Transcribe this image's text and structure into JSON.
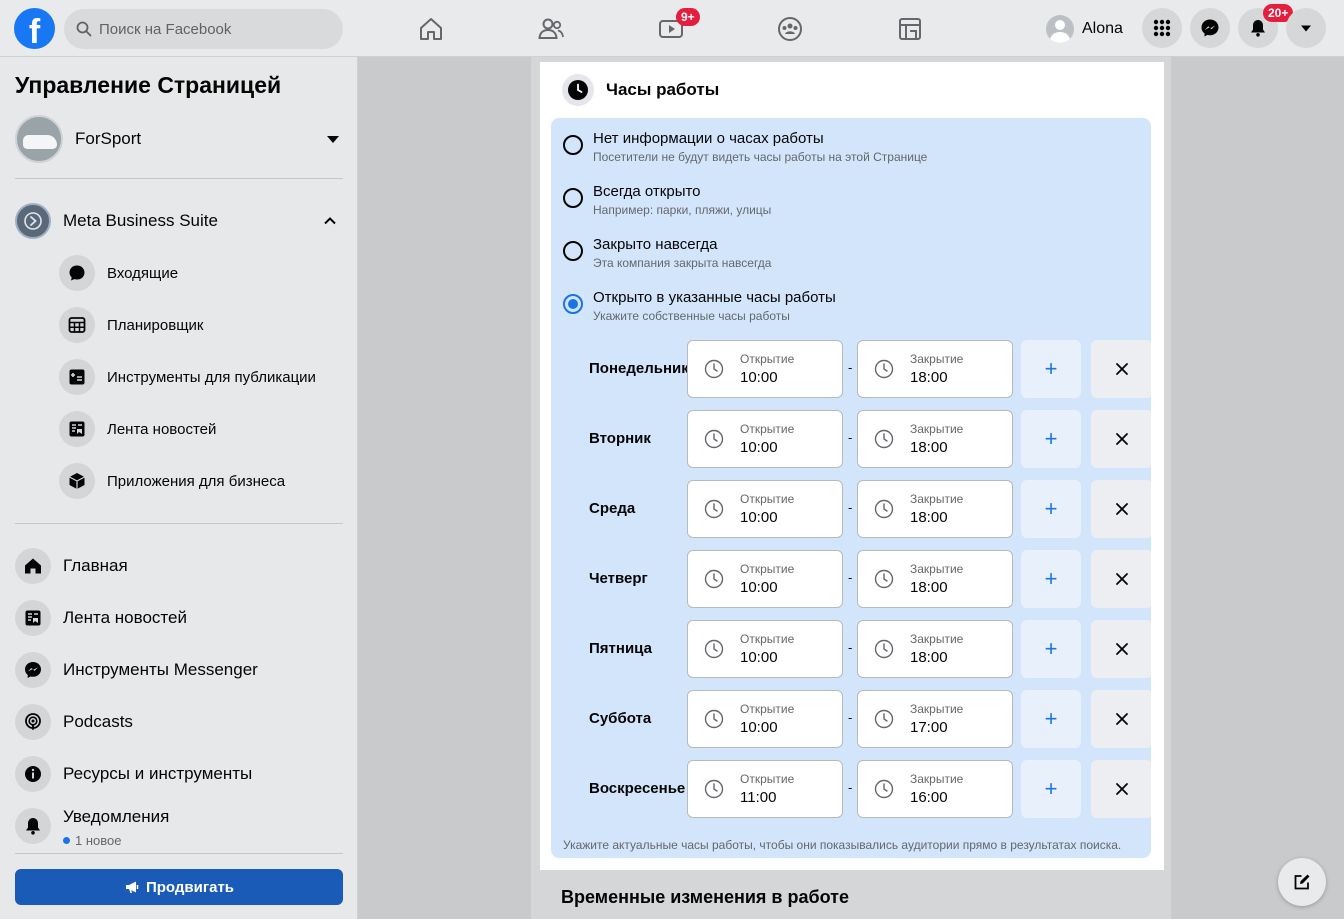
{
  "topbar": {
    "logo_letter": "f",
    "search_placeholder": "Поиск на Facebook",
    "watch_badge": "9+",
    "profile_name": "Alona",
    "notif_badge": "20+"
  },
  "sidebar": {
    "title": "Управление Страницей",
    "page_name": "ForSport",
    "suite_label": "Meta Business Suite",
    "suite_items": [
      {
        "label": "Входящие",
        "icon": "chat-icon"
      },
      {
        "label": "Планировщик",
        "icon": "calendar-icon"
      },
      {
        "label": "Инструменты для публикации",
        "icon": "publishing-tools-icon"
      },
      {
        "label": "Лента новостей",
        "icon": "news-feed-icon"
      },
      {
        "label": "Приложения для бизнеса",
        "icon": "cube-icon"
      }
    ],
    "main_items": [
      {
        "label": "Главная",
        "icon": "home-icon"
      },
      {
        "label": "Лента новостей",
        "icon": "news-feed-icon"
      },
      {
        "label": "Инструменты Messenger",
        "icon": "messenger-icon"
      },
      {
        "label": "Podcasts",
        "icon": "podcast-icon"
      },
      {
        "label": "Ресурсы и инструменты",
        "icon": "info-icon"
      },
      {
        "label": "Уведомления",
        "icon": "bell-icon"
      }
    ],
    "notif_sub": "1 новое",
    "promote_label": "Продвигать"
  },
  "hours": {
    "title": "Часы работы",
    "options": [
      {
        "label": "Нет информации о часах работы",
        "desc": "Посетители не будут видеть часы работы на этой Странице",
        "selected": false
      },
      {
        "label": "Всегда открыто",
        "desc": "Например: парки, пляжи, улицы",
        "selected": false
      },
      {
        "label": "Закрыто навсегда",
        "desc": "Эта компания закрыта навсегда",
        "selected": false
      },
      {
        "label": "Открыто в указанные часы работы",
        "desc": "Укажите собственные часы работы",
        "selected": true
      }
    ],
    "open_caption": "Открытие",
    "close_caption": "Закрытие",
    "dash": "-",
    "plus": "+",
    "days": [
      {
        "name": "Понедельник",
        "open": "10:00",
        "close": "18:00"
      },
      {
        "name": "Вторник",
        "open": "10:00",
        "close": "18:00"
      },
      {
        "name": "Среда",
        "open": "10:00",
        "close": "18:00"
      },
      {
        "name": "Четверг",
        "open": "10:00",
        "close": "18:00"
      },
      {
        "name": "Пятница",
        "open": "10:00",
        "close": "18:00"
      },
      {
        "name": "Суббота",
        "open": "10:00",
        "close": "17:00"
      },
      {
        "name": "Воскресенье",
        "open": "11:00",
        "close": "16:00"
      }
    ],
    "hint": "Укажите актуальные часы работы, чтобы они показывались аудитории прямо в результатах поиска."
  },
  "next_section_title": "Временные изменения в работе",
  "colors": {
    "brand": "#1877f2",
    "accent": "#1b74e4",
    "badge": "#e41e3f",
    "panel": "#d3e5fb"
  }
}
